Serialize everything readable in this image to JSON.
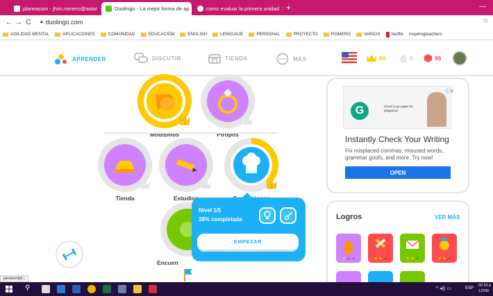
{
  "browser": {
    "tabs": [
      {
        "title": "planeacion - jhon.romero@astor",
        "active": false
      },
      {
        "title": "Duolingo - La mejor forma de ap",
        "active": true
      },
      {
        "title": "como evaluar la primera unidad",
        "active": false
      }
    ],
    "new_tab": "+",
    "url": "duolingo.com",
    "bookmarks": [
      "AGILIDAD MENTAL",
      "APLICACIONES",
      "COMUNIDAD",
      "EDUCACIÓN",
      "ENGLISH",
      "LENGUAJE",
      "PERSONAL",
      "PROYECTO",
      "ROMERO",
      "VARIOS",
      "Netflix",
      "inspiringteachers"
    ],
    "status_text": "javascript:;"
  },
  "nav": {
    "learn": "APRENDER",
    "discuss": "DISCUTIR",
    "shop": "TIENDA",
    "more": "MÁS"
  },
  "stats": {
    "crowns": "89",
    "streak": "0",
    "gems": "96"
  },
  "skills": [
    {
      "name": "Modismos",
      "color": "#ffc800"
    },
    {
      "name": "Piropos",
      "color": "#ce82ff"
    },
    {
      "name": "Tienda",
      "color": "#ce82ff"
    },
    {
      "name": "Estudios",
      "color": "#ce82ff"
    },
    {
      "name": "Ocupaciones",
      "color": "#1cb0f6"
    },
    {
      "name": "Encuen",
      "color": "#78c800"
    }
  ],
  "popup": {
    "level": "Nivel 1/5",
    "progress": "38% completada",
    "progress_value": 0.38,
    "start": "EMPEZAR"
  },
  "ad": {
    "headline": "Instantly Check Your Writing",
    "body": "Fix misplaced commas, misused words, grammar goofs, and more. Try now!",
    "cta": "OPEN",
    "mini_text": "Check your paper for plagiarism"
  },
  "achievements": {
    "title": "Logros",
    "see_more": "VER MÁS"
  },
  "taskbar": {
    "lang": "ESP",
    "time": "02:52 p",
    "date": "12/08/"
  }
}
